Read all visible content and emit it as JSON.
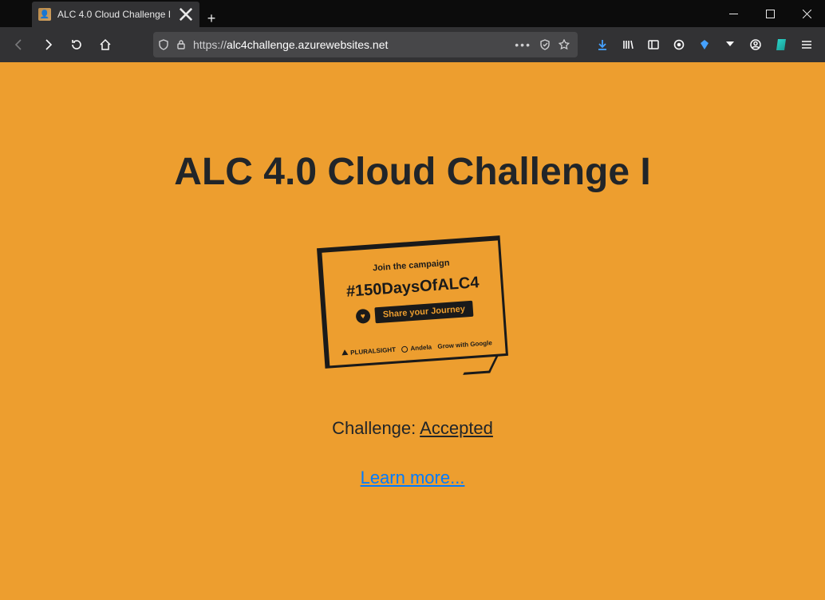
{
  "window": {
    "tab_title": "ALC 4.0 Cloud Challenge I",
    "url_protocol": "https://",
    "url_host": "alc4challenge.azurewebsites.net",
    "url_path": ""
  },
  "page": {
    "heading": "ALC 4.0 Cloud Challenge I",
    "campaign": {
      "kicker": "Join the campaign",
      "hashtag": "#150DaysOfALC4",
      "share_label": "Share your Journey",
      "sponsors": [
        "PLURALSIGHT",
        "Andela",
        "Grow with Google"
      ]
    },
    "status_prefix": "Challenge: ",
    "status_value": "Accepted",
    "learn_more": "Learn more..."
  }
}
